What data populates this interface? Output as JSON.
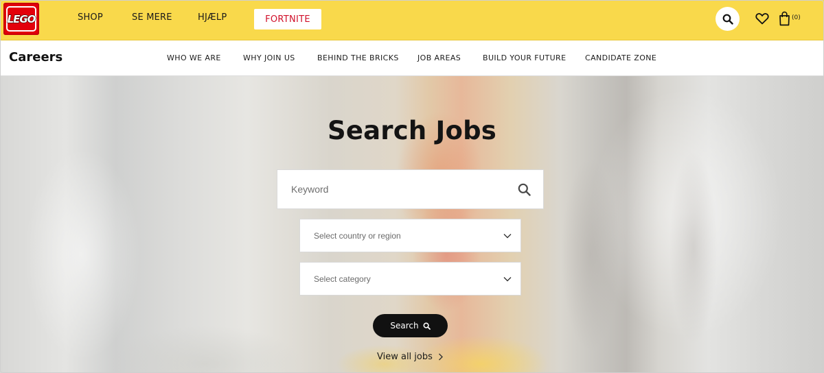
{
  "brand": {
    "logo_text": "LEGO"
  },
  "topnav": {
    "items": [
      "SHOP",
      "SE MERE",
      "HJÆLP"
    ],
    "fortnite_label": "FORTNITE",
    "bag_count": "(0)"
  },
  "subnav": {
    "title": "Careers",
    "items": [
      "WHO WE ARE",
      "WHY JOIN US",
      "BEHIND THE BRICKS",
      "JOB AREAS",
      "BUILD YOUR FUTURE",
      "CANDIDATE ZONE"
    ]
  },
  "hero": {
    "title": "Search Jobs",
    "keyword_placeholder": "Keyword",
    "country_select": "Select country or region",
    "category_select": "Select category",
    "search_button": "Search",
    "view_all": "View all jobs"
  },
  "colors": {
    "topbar": "#f9d94b",
    "logo_red": "#e3000b",
    "fortnite_text": "#d0102a",
    "button_dark": "#111111"
  },
  "icons": [
    "search-icon",
    "heart-icon",
    "bag-icon",
    "chevron-down-icon",
    "chevron-right-icon"
  ]
}
